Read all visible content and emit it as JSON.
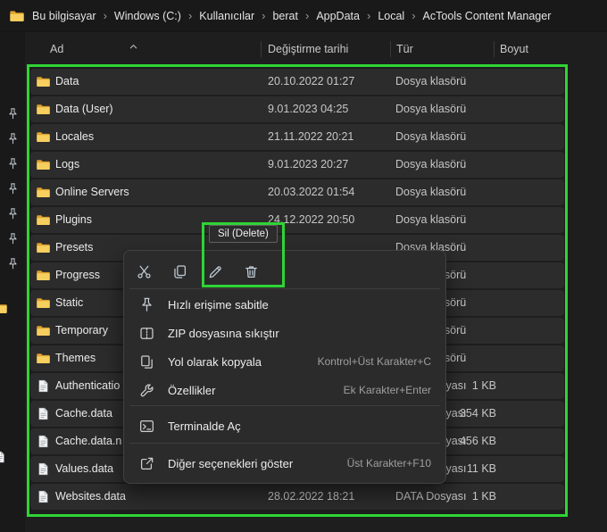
{
  "colors": {
    "annotation_green": "#2fd435"
  },
  "breadcrumb": {
    "separator": "›",
    "items": [
      "Bu bilgisayar",
      "Windows (C:)",
      "Kullanıcılar",
      "berat",
      "AppData",
      "Local",
      "AcTools Content Manager"
    ]
  },
  "columns": {
    "name": "Ad",
    "date": "Değiştirme tarihi",
    "type": "Tür",
    "size": "Boyut"
  },
  "sort": {
    "column": "Ad",
    "direction": "asc"
  },
  "left_rail": {
    "pinned_count": 7
  },
  "rows": [
    {
      "name": "Data",
      "date": "20.10.2022 01:27",
      "type": "Dosya klasörü",
      "size": "",
      "kind": "folder"
    },
    {
      "name": "Data (User)",
      "date": "9.01.2023 04:25",
      "type": "Dosya klasörü",
      "size": "",
      "kind": "folder"
    },
    {
      "name": "Locales",
      "date": "21.11.2022 20:21",
      "type": "Dosya klasörü",
      "size": "",
      "kind": "folder"
    },
    {
      "name": "Logs",
      "date": "9.01.2023 20:27",
      "type": "Dosya klasörü",
      "size": "",
      "kind": "folder"
    },
    {
      "name": "Online Servers",
      "date": "20.03.2022 01:54",
      "type": "Dosya klasörü",
      "size": "",
      "kind": "folder"
    },
    {
      "name": "Plugins",
      "date": "24.12.2022 20:50",
      "type": "Dosya klasörü",
      "size": "",
      "kind": "folder"
    },
    {
      "name": "Presets",
      "date": "",
      "type": "Dosya klasörü",
      "size": "",
      "kind": "folder"
    },
    {
      "name": "Progress",
      "date": "",
      "type": "Dosya klasörü",
      "size": "",
      "kind": "folder"
    },
    {
      "name": "Static",
      "date": "",
      "type": "Dosya klasörü",
      "size": "",
      "kind": "folder"
    },
    {
      "name": "Temporary",
      "date": "",
      "type": "Dosya klasörü",
      "size": "",
      "kind": "folder"
    },
    {
      "name": "Themes",
      "date": "",
      "type": "Dosya klasörü",
      "size": "",
      "kind": "folder"
    },
    {
      "name": "Authenticatio",
      "date": "",
      "type": "DATA Dosyası",
      "size": "1 KB",
      "kind": "file"
    },
    {
      "name": "Cache.data",
      "date": "",
      "type": "DATA Dosyası",
      "size": "354 KB",
      "kind": "file"
    },
    {
      "name": "Cache.data.n",
      "date": "",
      "type": "DATA Dosyası",
      "size": "456 KB",
      "kind": "file"
    },
    {
      "name": "Values.data",
      "date": "",
      "type": "DATA Dosyası",
      "size": "11 KB",
      "kind": "file"
    },
    {
      "name": "Websites.data",
      "date": "28.02.2022 18:21",
      "type": "DATA Dosyası",
      "size": "1 KB",
      "kind": "file"
    }
  ],
  "context_menu": {
    "tooltip": "Sil (Delete)",
    "quick_actions": [
      {
        "id": "cut"
      },
      {
        "id": "copy"
      },
      {
        "id": "rename"
      },
      {
        "id": "delete"
      }
    ],
    "items": [
      {
        "icon": "pin",
        "label": "Hızlı erişime sabitle",
        "shortcut": ""
      },
      {
        "icon": "zip",
        "label": "ZIP dosyasına sıkıştır",
        "shortcut": ""
      },
      {
        "icon": "copy-path",
        "label": "Yol olarak kopyala",
        "shortcut": "Kontrol+Üst Karakter+C"
      },
      {
        "icon": "properties",
        "label": "Özellikler",
        "shortcut": "Ek Karakter+Enter"
      },
      {
        "icon": "terminal",
        "label": "Terminalde Aç",
        "shortcut": "",
        "separator_before": true
      },
      {
        "icon": "more",
        "label": "Diğer seçenekleri göster",
        "shortcut": "Üst Karakter+F10",
        "separator_before": true
      }
    ]
  }
}
